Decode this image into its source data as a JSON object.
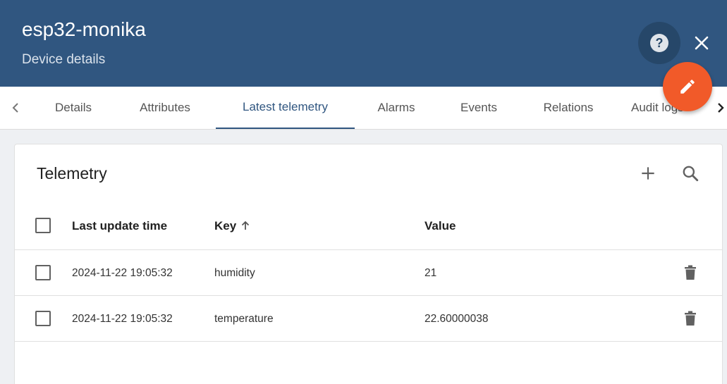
{
  "header": {
    "title": "esp32-monika",
    "subtitle": "Device details"
  },
  "tabs": [
    {
      "label": "Details",
      "active": false
    },
    {
      "label": "Attributes",
      "active": false
    },
    {
      "label": "Latest telemetry",
      "active": true
    },
    {
      "label": "Alarms",
      "active": false
    },
    {
      "label": "Events",
      "active": false
    },
    {
      "label": "Relations",
      "active": false
    },
    {
      "label": "Audit logs",
      "active": false
    }
  ],
  "card": {
    "title": "Telemetry",
    "columns": {
      "last_update": "Last update time",
      "key": "Key",
      "value": "Value"
    },
    "rows": [
      {
        "time": "2024-11-22 19:05:32",
        "key": "humidity",
        "value": "21"
      },
      {
        "time": "2024-11-22 19:05:32",
        "key": "temperature",
        "value": "22.60000038"
      }
    ]
  },
  "colors": {
    "header_bg": "#305680",
    "accent_fab": "#f15a29"
  },
  "icons": [
    "help-icon",
    "close-icon",
    "edit-icon",
    "chevron-left-icon",
    "chevron-right-icon",
    "add-icon",
    "search-icon",
    "arrow-up-icon",
    "trash-icon"
  ]
}
